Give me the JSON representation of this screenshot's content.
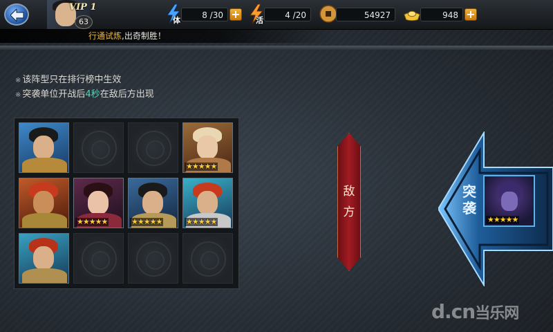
{
  "topbar": {
    "vip": "VIP 1",
    "level": "63",
    "stamina_label": "体",
    "stamina_value": "8 /30",
    "energy_label": "活",
    "energy_value": "4 /20",
    "coins_value": "54927",
    "gold_value": "948",
    "plus_symbol": "+"
  },
  "ticker": {
    "highlight": "行通试炼",
    "text": ",出奇制胜！"
  },
  "notes": {
    "bullet": "※",
    "line1": "该阵型只在排行榜中生效",
    "line2_prefix": "突袭单位开战后",
    "line2_highlight": "4秒",
    "line2_suffix": "在敌后方出现"
  },
  "formation": {
    "cells": [
      {
        "type": "hero",
        "stars": ""
      },
      {
        "type": "empty"
      },
      {
        "type": "empty"
      },
      {
        "type": "hero",
        "stars": "★★★★★"
      },
      {
        "type": "hero",
        "stars": ""
      },
      {
        "type": "hero",
        "stars": "★★★★★"
      },
      {
        "type": "hero",
        "stars": "★★★★★"
      },
      {
        "type": "hero",
        "stars": "★★★★★"
      },
      {
        "type": "hero",
        "stars": ""
      },
      {
        "type": "empty"
      },
      {
        "type": "empty"
      },
      {
        "type": "empty"
      }
    ]
  },
  "enemy_banner": {
    "char1": "敌",
    "char2": "方"
  },
  "raid": {
    "char1": "突",
    "char2": "袭",
    "stars": "★★★★★"
  },
  "watermark": {
    "brand": "d.cn",
    "sub": "当乐网"
  },
  "colors": {
    "highlight_gold": "#e7b64a",
    "highlight_teal": "#5fd0b8",
    "banner_red": "#a11b22",
    "raid_blue": "#2a7cc4"
  }
}
